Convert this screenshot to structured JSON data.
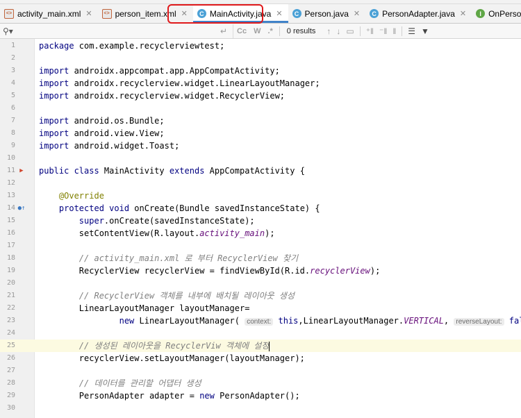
{
  "tabs": [
    {
      "label": "activity_main.xml",
      "icon": "xml-file-icon",
      "active": false
    },
    {
      "label": "person_item.xml",
      "icon": "xml-file-icon",
      "active": false
    },
    {
      "label": "MainActivity.java",
      "icon": "class-icon",
      "active": true
    },
    {
      "label": "Person.java",
      "icon": "class-icon",
      "active": false
    },
    {
      "label": "PersonAdapter.java",
      "icon": "class-icon",
      "active": false
    },
    {
      "label": "OnPersonItemClickListener.ja",
      "icon": "interface-icon",
      "active": false
    }
  ],
  "icon_glyphs": {
    "xml": "<>",
    "class": "C",
    "interface": "I"
  },
  "find": {
    "query": "",
    "match_case": "Cc",
    "words": "W",
    "regex": ".*",
    "results": "0 results"
  },
  "colors": {
    "highlight_border": "#e0191b",
    "active_tab_underline": "#4083c9"
  },
  "code_lines": [
    {
      "n": "1",
      "html": "<span class=\"kw\">package</span> com.example.recyclerviewtest;"
    },
    {
      "n": "2",
      "html": ""
    },
    {
      "n": "3",
      "html": "<span class=\"kw\">import</span> androidx.appcompat.app.AppCompatActivity;"
    },
    {
      "n": "4",
      "html": "<span class=\"kw\">import</span> androidx.recyclerview.widget.LinearLayoutManager;"
    },
    {
      "n": "5",
      "html": "<span class=\"kw\">import</span> androidx.recyclerview.widget.RecyclerView;"
    },
    {
      "n": "6",
      "html": ""
    },
    {
      "n": "7",
      "html": "<span class=\"kw\">import</span> android.os.Bundle;"
    },
    {
      "n": "8",
      "html": "<span class=\"kw\">import</span> android.view.View;"
    },
    {
      "n": "9",
      "html": "<span class=\"kw\">import</span> android.widget.Toast;"
    },
    {
      "n": "10",
      "html": ""
    },
    {
      "n": "11",
      "html": "<span class=\"kw\">public class</span> MainActivity <span class=\"kw\">extends</span> AppCompatActivity {"
    },
    {
      "n": "12",
      "html": ""
    },
    {
      "n": "13",
      "html": "    <span class=\"ann\">@Override</span>"
    },
    {
      "n": "14",
      "html": "    <span class=\"kw\">protected void</span> onCreate(Bundle savedInstanceState) {"
    },
    {
      "n": "15",
      "html": "        <span class=\"kw\">super</span>.onCreate(savedInstanceState);"
    },
    {
      "n": "16",
      "html": "        setContentView(R.layout.<span class=\"fld\">activity_main</span>);"
    },
    {
      "n": "17",
      "html": ""
    },
    {
      "n": "18",
      "html": "        <span class=\"cm\">// activity_main.xml 로 부터 RecyclerView 찾기</span>"
    },
    {
      "n": "19",
      "html": "        RecyclerView recyclerView = findViewById(R.id.<span class=\"fld\">recyclerView</span>);"
    },
    {
      "n": "20",
      "html": ""
    },
    {
      "n": "21",
      "html": "        <span class=\"cm\">// RecyclerView 객체를 내부에 배치될 레이아웃 생성</span>"
    },
    {
      "n": "22",
      "html": "        LinearLayoutManager layoutManager="
    },
    {
      "n": "23",
      "html": "                <span class=\"kw\">new</span> LinearLayoutManager( <span class=\"hint\">context:</span> <span class=\"kw\">this</span>,LinearLayoutManager.<span class=\"fld\">VERTICAL</span>, <span class=\"hint\">reverseLayout:</span> <span class=\"kw\">false</span>);"
    },
    {
      "n": "24",
      "html": ""
    },
    {
      "n": "25",
      "html": "        <span class=\"cm\">// 생성된 레이아웃을 RecyclerViw 객체에 설정</span><span class=\"caret\"></span>",
      "current": true
    },
    {
      "n": "26",
      "html": "        recyclerView.setLayoutManager(layoutManager);"
    },
    {
      "n": "27",
      "html": ""
    },
    {
      "n": "28",
      "html": "        <span class=\"cm\">// 데이터를 관리할 어댑터 생성</span>"
    },
    {
      "n": "29",
      "html": "        PersonAdapter adapter = <span class=\"kw\">new</span> PersonAdapter();"
    },
    {
      "n": "30",
      "html": ""
    }
  ],
  "gutter_marks": {
    "11": "run-class-icon",
    "14": "override-method-icon"
  }
}
